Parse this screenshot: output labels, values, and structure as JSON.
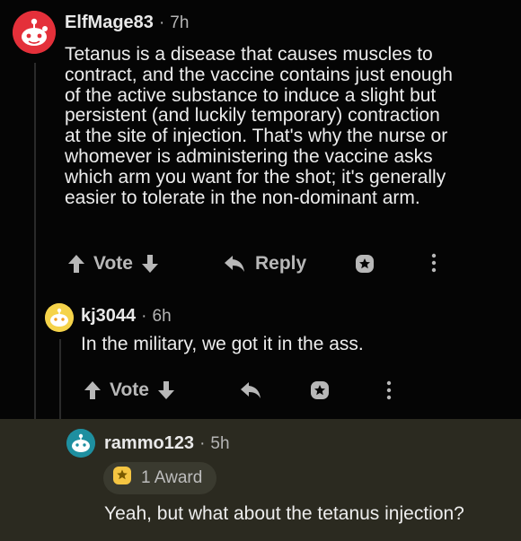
{
  "comment1": {
    "username": "ElfMage83",
    "age": "7h",
    "body_lines": [
      "Tetanus is a disease that causes muscles to",
      "contract, and the vaccine contains just enough",
      "of the active substance to induce a slight but",
      "persistent (and luckily temporary) contraction",
      "at the site of injection. That's why the nurse or",
      "whomever is administering the vaccine asks",
      "which arm you want for the shot; it's generally",
      "easier to tolerate in the non-dominant arm."
    ],
    "vote_label": "Vote",
    "reply_label": "Reply"
  },
  "comment2": {
    "username": "kj3044",
    "age": "6h",
    "body": "In the military, we got it in the ass.",
    "vote_label": "Vote"
  },
  "comment3": {
    "username": "rammo123",
    "age": "5h",
    "award_label": "1 Award",
    "body": "Yeah, but what about the tetanus injection?"
  },
  "colors": {
    "background": "#050505",
    "highlight": "#2b2a20",
    "text": "#ededed",
    "muted": "#b8b8b8",
    "avatar_red": "#e4303a",
    "avatar_yellow": "#f5d34a",
    "avatar_teal": "#1e8fa0"
  },
  "icons": [
    "avatar-snoo",
    "upvote-arrow-icon",
    "downvote-arrow-icon",
    "reply-arrow-icon",
    "award-icon",
    "more-options-icon"
  ]
}
